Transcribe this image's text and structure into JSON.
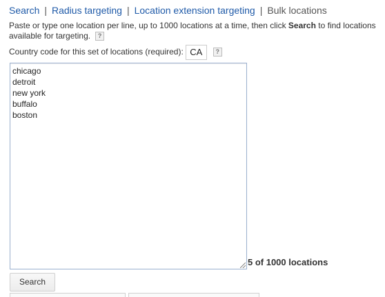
{
  "tabs": {
    "search": "Search",
    "separator": "|",
    "radius": "Radius targeting",
    "location_extension": "Location extension targeting",
    "bulk": "Bulk locations"
  },
  "instructions": {
    "before_bold": "Paste or type one location per line, up to 1000 locations at a time, then click ",
    "bold": "Search",
    "after_bold": " to find locations available for targeting."
  },
  "help_icon_glyph": "?",
  "country": {
    "label": "Country code for this set of locations (required):",
    "value": "CA"
  },
  "locations": [
    "chicago",
    "detroit",
    "new york",
    "buffalo",
    "boston"
  ],
  "count_text": "5 of 1000 locations",
  "search_button_label": "Search",
  "colors": {
    "link": "#1f5aa8",
    "textarea_border": "#9ab0cf"
  }
}
